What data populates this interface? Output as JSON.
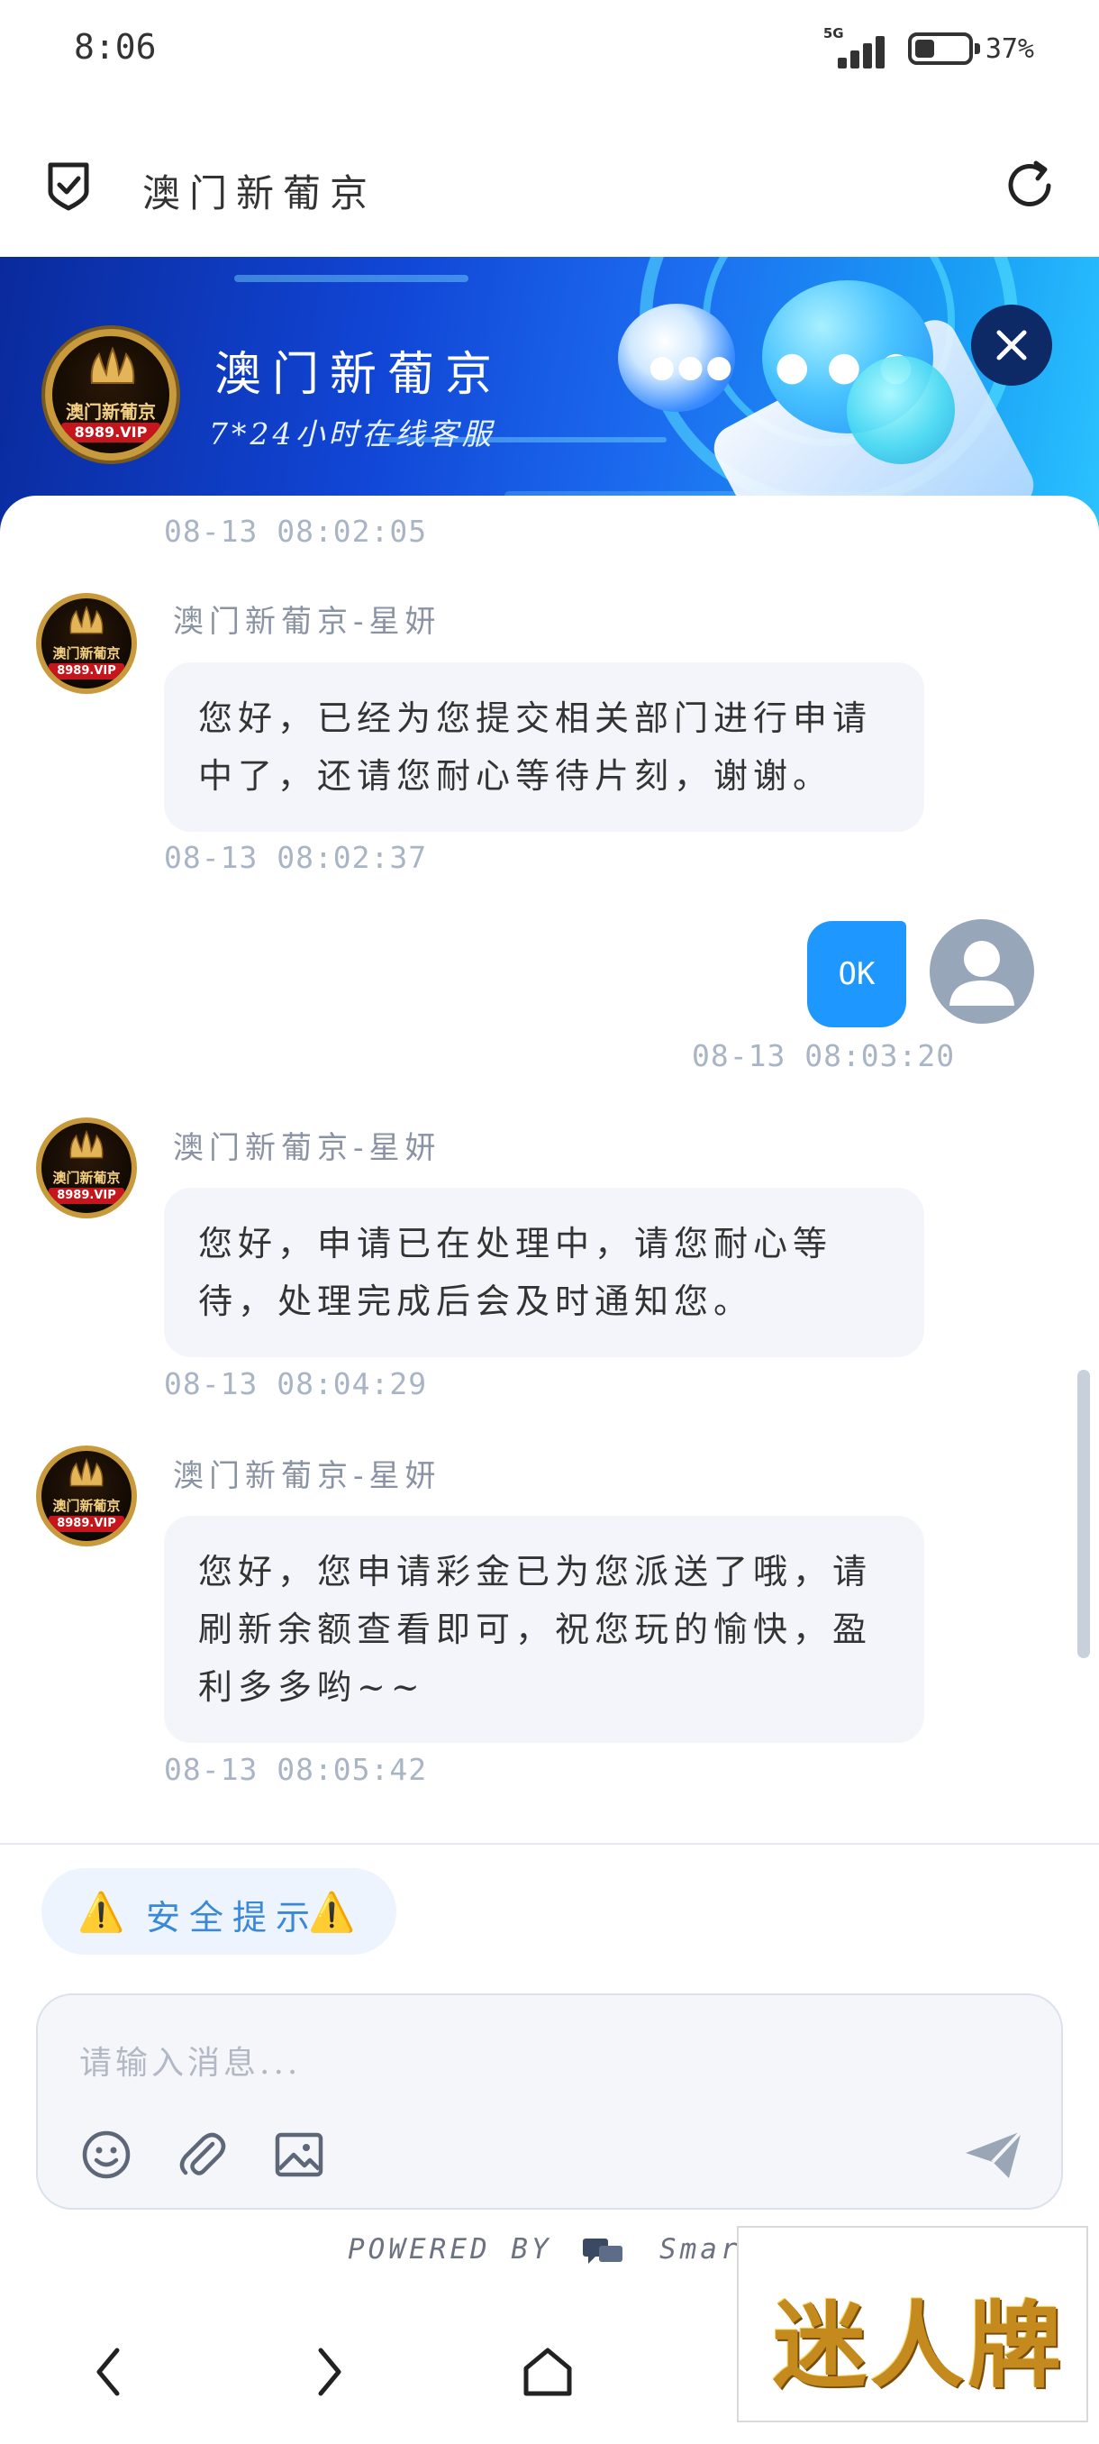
{
  "status_bar": {
    "time": "8:06",
    "network": "5G",
    "battery": "37%",
    "battery_level": 0.37
  },
  "header": {
    "title": "澳门新葡京"
  },
  "banner": {
    "title": "澳门新葡京",
    "subtitle": "7*24小时在线客服",
    "logo_text": "澳门新葡京",
    "logo_badge": "8989.VIP"
  },
  "messages": [
    {
      "type": "timestamp",
      "text": "08-13 08:02:05"
    },
    {
      "type": "agent",
      "name": "澳门新葡京-星妍",
      "text": "您好，已经为您提交相关部门进行申请中了，还请您耐心等待片刻，谢谢。",
      "time": "08-13 08:02:37"
    },
    {
      "type": "user",
      "text": "OK",
      "time": "08-13 08:03:20"
    },
    {
      "type": "agent",
      "name": "澳门新葡京-星妍",
      "text": "您好，申请已在处理中，请您耐心等待，处理完成后会及时通知您。",
      "time": "08-13 08:04:29"
    },
    {
      "type": "agent",
      "name": "澳门新葡京-星妍",
      "text": "您好，您申请彩金已为您派送了哦，请刷新余额查看即可，祝您玩的愉快，盈利多多哟~~",
      "time": "08-13 08:05:42"
    }
  ],
  "avatar_badge": {
    "text": "澳门新葡京",
    "vip": "8989.VIP"
  },
  "composer": {
    "safety_label": "安全提示",
    "warning_glyph": "⚠️",
    "placeholder": "请输入消息...",
    "icons": [
      "emoji-icon",
      "attachment-icon",
      "image-icon",
      "send-icon"
    ]
  },
  "footer": {
    "powered_prefix": "POWERED BY",
    "powered_brand": "SmartCha"
  },
  "watermark": {
    "text": "迷人牌"
  },
  "colors": {
    "accent": "#1e98ff",
    "bubble": "#f3f5fa",
    "timestamp": "#a9b4c4"
  }
}
